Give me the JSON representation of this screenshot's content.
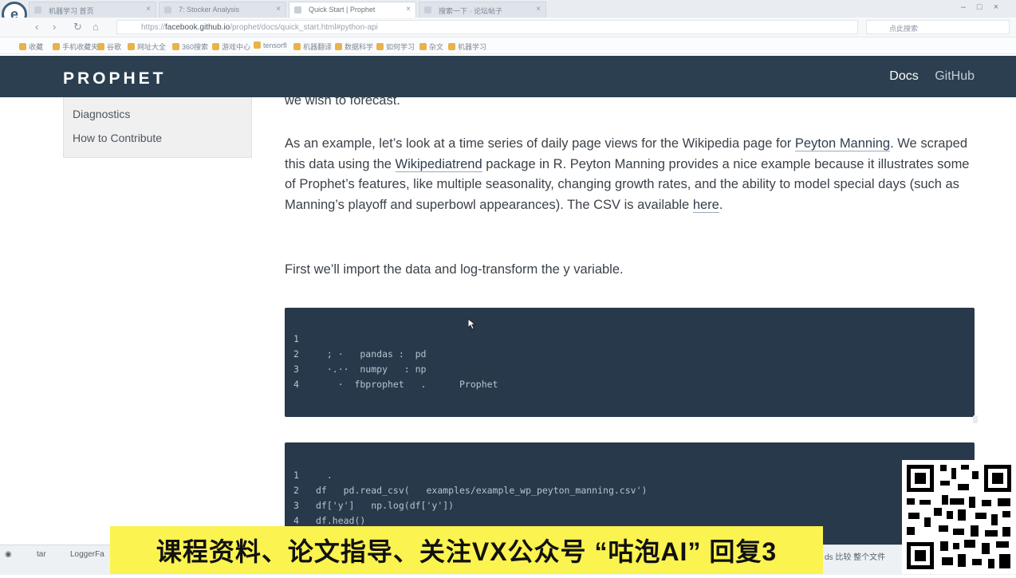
{
  "browser": {
    "tabs": [
      {
        "label": "机器学习 首页"
      },
      {
        "label": "7: Stocker Analysis"
      },
      {
        "label": "Quick Start | Prophet"
      },
      {
        "label": "搜索一下 · 论坛帖子"
      }
    ],
    "url_prefix": "https://",
    "url_host": "facebook.github.io",
    "url_path": "/prophet/docs/quick_start.html#python-api",
    "search_placeholder": "点此搜索",
    "bookmarks": [
      "收藏",
      "手机收藏夹",
      "谷歌",
      "网址大全",
      "360搜索",
      "游戏中心",
      "tensorfl",
      "机器翻译",
      "数据科学",
      "如何学习",
      "杂文",
      "机器学习"
    ]
  },
  "site": {
    "logo": "PROPHET",
    "nav": {
      "docs": "Docs",
      "github": "GitHub"
    }
  },
  "sidebar": {
    "items": [
      {
        "label": "Diagnostics"
      },
      {
        "label": "How to Contribute"
      }
    ]
  },
  "content": {
    "p0": "we wish to forecast.",
    "p1_a": "As an example, let’s look at a time series of daily page views for the Wikipedia page for ",
    "p1_link1": "Peyton Manning",
    "p1_b": ". We scraped this data using the ",
    "p1_link2": "Wikipediatrend",
    "p1_c": " package in R. Peyton Manning provides a nice example because it illustrates some of Prophet’s features, like multiple seasonality, changing growth rates, and the ability to model special days (such as Manning’s playoff and superbowl appearances). The CSV is available ",
    "p1_link3": "here",
    "p1_d": ".",
    "p2": "First we’ll import the data and log-transform the y variable."
  },
  "code_block_1": {
    "lines": [
      {
        "n": "1",
        "text": ""
      },
      {
        "n": "2",
        "text": "  ; ·   pandas :  pd"
      },
      {
        "n": "3",
        "text": "  ·.··  numpy   : np"
      },
      {
        "n": "4",
        "text": "    ·  fbprophet   .      Prophet"
      }
    ]
  },
  "code_block_2": {
    "lines": [
      {
        "n": "1",
        "text": "  ."
      },
      {
        "n": "2",
        "text": "df   pd.read_csv(   examples/example_wp_peyton_manning.csv')"
      },
      {
        "n": "3",
        "text": "df['y']   np.log(df['y'])"
      },
      {
        "n": "4",
        "text": "df.head()"
      }
    ]
  },
  "overlay": {
    "banner": "课程资料、论文指导、关注VX公众号 “咕泡AI” 回复3"
  },
  "taskbar": {
    "items": [
      "tar",
      "LoggerFa"
    ],
    "right_text": "ds 比较 整个文件"
  }
}
